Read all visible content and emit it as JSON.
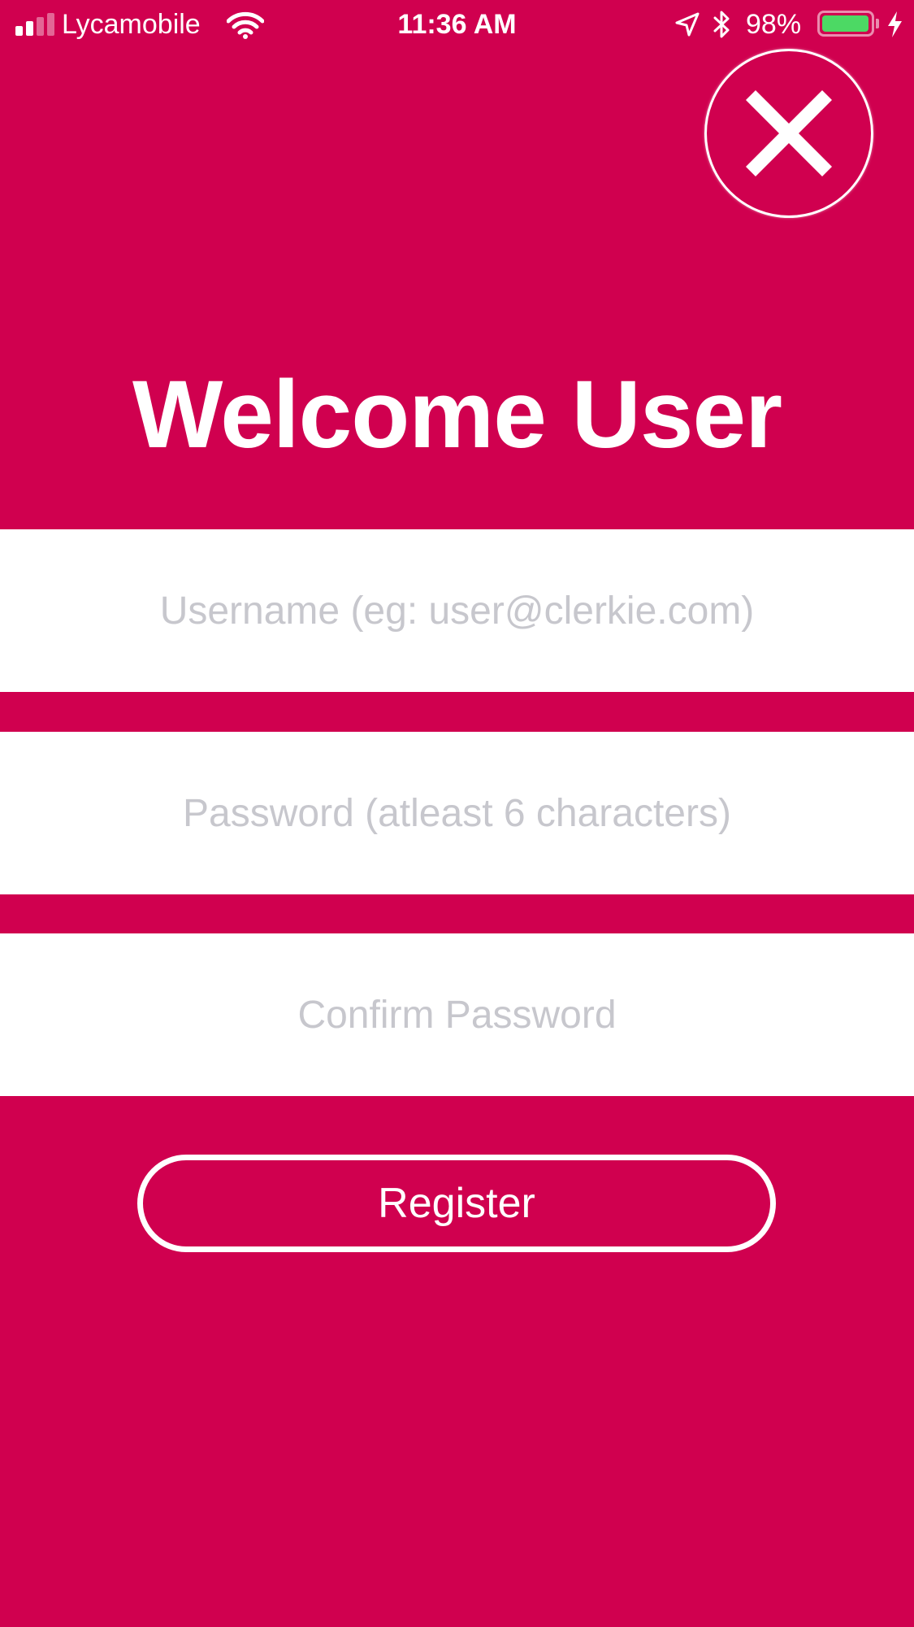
{
  "status_bar": {
    "carrier": "Lycamobile",
    "time": "11:36 AM",
    "battery_percent": "98%",
    "battery_level": 0.98,
    "signal_bars_active": 2,
    "signal_bars_total": 4,
    "battery_color": "#4CD964"
  },
  "close": {
    "icon": "close-icon"
  },
  "title": "Welcome User",
  "form": {
    "username": {
      "value": "",
      "placeholder": "Username (eg: user@clerkie.com)"
    },
    "password": {
      "value": "",
      "placeholder": "Password (atleast 6 characters)"
    },
    "confirm_password": {
      "value": "",
      "placeholder": "Confirm Password"
    }
  },
  "register_label": "Register",
  "colors": {
    "background": "#D0004F",
    "field_background": "#FFFFFF",
    "placeholder": "#C7C7CD",
    "foreground": "#FFFFFF"
  }
}
